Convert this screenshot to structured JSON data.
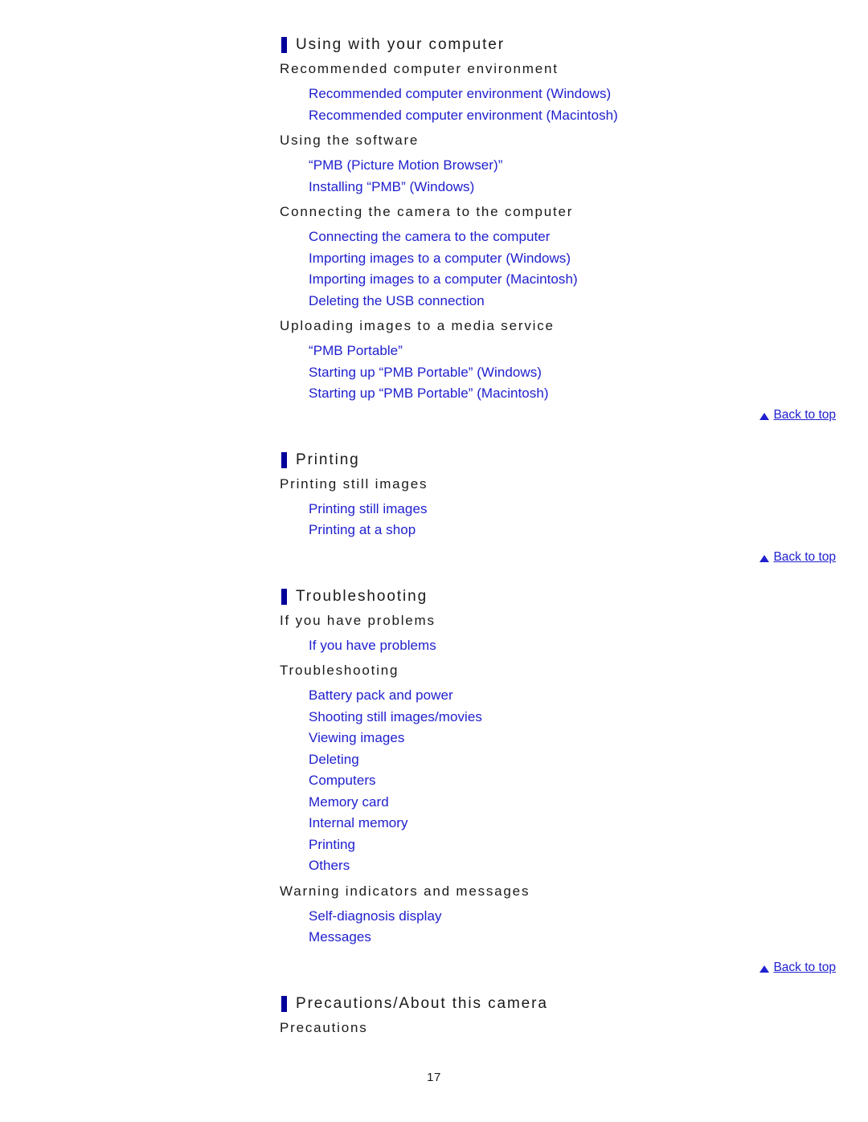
{
  "page": {
    "number": "17",
    "back_to_top_label": "Back to top"
  },
  "sections": [
    {
      "title": "Using with your computer",
      "groups": [
        {
          "heading": "Recommended computer environment",
          "links": [
            "Recommended computer environment (Windows)",
            "Recommended computer environment (Macintosh)"
          ]
        },
        {
          "heading": "Using the software",
          "links": [
            "“PMB (Picture Motion Browser)”",
            "Installing “PMB” (Windows)"
          ]
        },
        {
          "heading": "Connecting the camera to the computer",
          "links": [
            "Connecting the camera to the computer",
            "Importing images to a computer (Windows)",
            "Importing images to a computer (Macintosh)",
            "Deleting the USB connection"
          ]
        },
        {
          "heading": "Uploading images to a media service",
          "links": [
            "“PMB Portable”",
            "Starting up “PMB Portable” (Windows)",
            "Starting up “PMB Portable” (Macintosh)"
          ]
        }
      ]
    },
    {
      "title": "Printing",
      "groups": [
        {
          "heading": "Printing still images",
          "links": [
            "Printing still images",
            "Printing at a shop"
          ]
        }
      ]
    },
    {
      "title": "Troubleshooting",
      "groups": [
        {
          "heading": "If you have problems",
          "links": [
            "If you have problems"
          ]
        },
        {
          "heading": "Troubleshooting",
          "links": [
            "Battery pack and power",
            "Shooting still images/movies",
            "Viewing images",
            "Deleting",
            "Computers",
            "Memory card",
            "Internal memory",
            "Printing",
            "Others"
          ]
        },
        {
          "heading": "Warning indicators and messages",
          "links": [
            "Self-diagnosis display",
            "Messages"
          ]
        }
      ]
    },
    {
      "title": "Precautions/About this camera",
      "groups": [
        {
          "heading": "Precautions",
          "links": []
        }
      ]
    }
  ],
  "colors": {
    "link": "#2020cf",
    "accent_bar": "#00009a",
    "text": "#1a1a1a"
  }
}
